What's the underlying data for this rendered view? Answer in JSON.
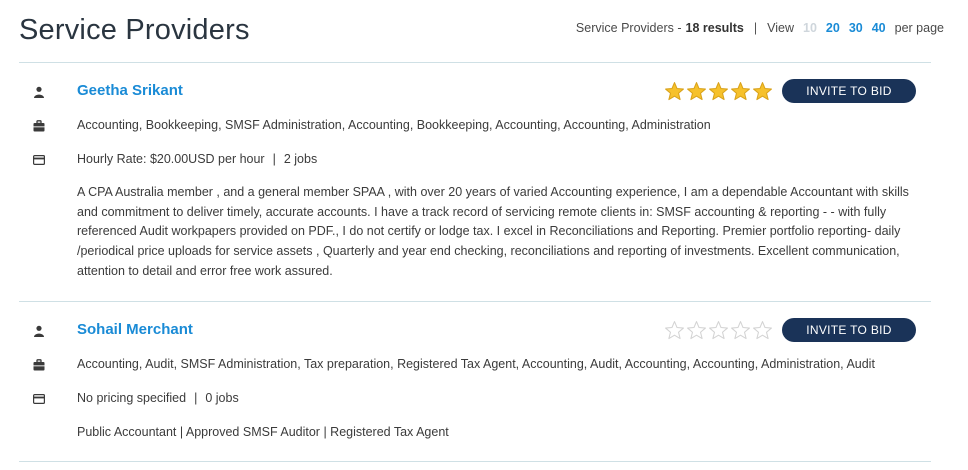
{
  "page_title": "Service Providers",
  "results": {
    "prefix": "Service Providers -",
    "count": "18 results",
    "separator": "|",
    "view_label": "View",
    "page_sizes": [
      "10",
      "20",
      "30",
      "40"
    ],
    "active_page_size": "10",
    "per_page_label": "per page"
  },
  "colors": {
    "link_blue": "#1a8bd6",
    "button_navy": "#1a3358",
    "star_gold": "#f6c12b",
    "star_empty": "#e3e3e3",
    "divider": "#cfe0e5"
  },
  "icons": {
    "person": "user-icon",
    "category": "briefcase-icon",
    "rate": "credit-card-icon"
  },
  "providers": [
    {
      "name": "Geetha Srikant",
      "rating": 5,
      "rating_max": 5,
      "invite_label": "INVITE TO BID",
      "services": "Accounting, Bookkeeping, SMSF Administration, Accounting, Bookkeeping, Accounting, Accounting, Administration",
      "rate": "Hourly Rate: $20.00USD per hour",
      "jobs": "2 jobs",
      "description": "A CPA Australia member , and a general member SPAA , with over 20 years of varied Accounting experience, I am a dependable Accountant with skills and commitment to deliver timely, accurate accounts. I have a track record of servicing remote clients in: SMSF accounting & reporting - - with fully referenced Audit workpapers provided on PDF., I do not certify or lodge tax. I excel in Reconciliations and Reporting. Premier portfolio reporting- daily /periodical price uploads for service assets , Quarterly and year end checking, reconciliations and reporting of investments. Excellent communication, attention to detail and error free work assured."
    },
    {
      "name": "Sohail Merchant",
      "rating": 0,
      "rating_max": 5,
      "invite_label": "INVITE TO BID",
      "services": "Accounting, Audit, SMSF Administration, Tax preparation, Registered Tax Agent, Accounting, Audit, Accounting, Accounting, Administration, Audit",
      "rate": "No pricing specified",
      "jobs": "0 jobs",
      "description": "Public Accountant | Approved SMSF Auditor | Registered Tax Agent"
    }
  ]
}
